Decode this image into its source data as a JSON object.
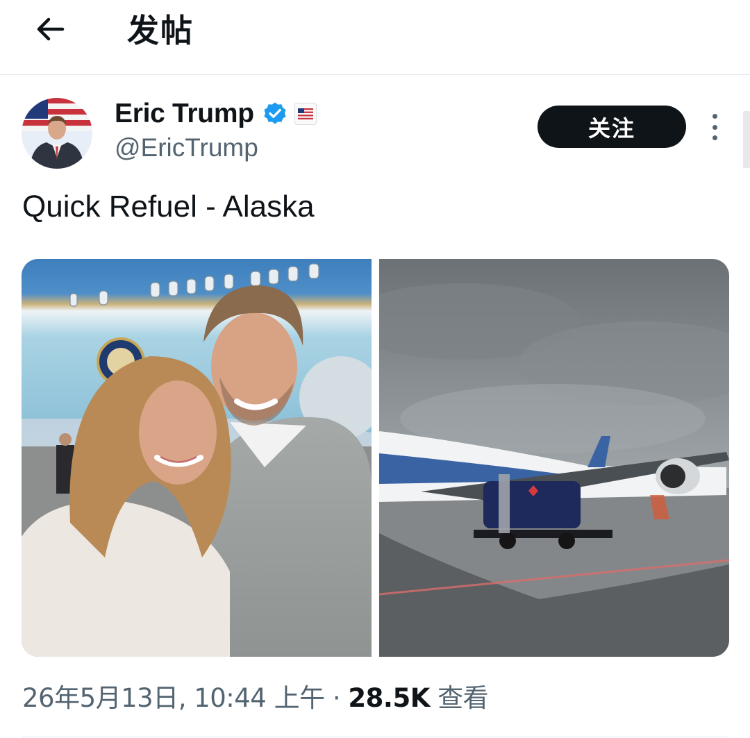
{
  "header": {
    "title": "发帖",
    "back_icon": "arrow-left-icon"
  },
  "author": {
    "display_name": "Eric Trump",
    "handle": "@EricTrump",
    "verified_icon": "verified-badge-icon",
    "verified_color": "#1d9bf0",
    "affiliation_icon": "us-flag-badge-icon"
  },
  "actions": {
    "follow_label": "关注",
    "more_icon": "more-vertical-icon"
  },
  "post": {
    "text": "Quick Refuel - Alaska",
    "media": [
      {
        "label": "selfie-photo"
      },
      {
        "label": "aircraft-refuel-photo"
      }
    ]
  },
  "meta": {
    "timestamp": "26年5月13日, 10:44 上午",
    "separator": " · ",
    "views_count": "28.5K",
    "views_label": " 查看"
  },
  "colors": {
    "text_primary": "#0f1419",
    "text_secondary": "#536471",
    "divider": "#e3e7ea",
    "button_dark": "#0f1419"
  }
}
